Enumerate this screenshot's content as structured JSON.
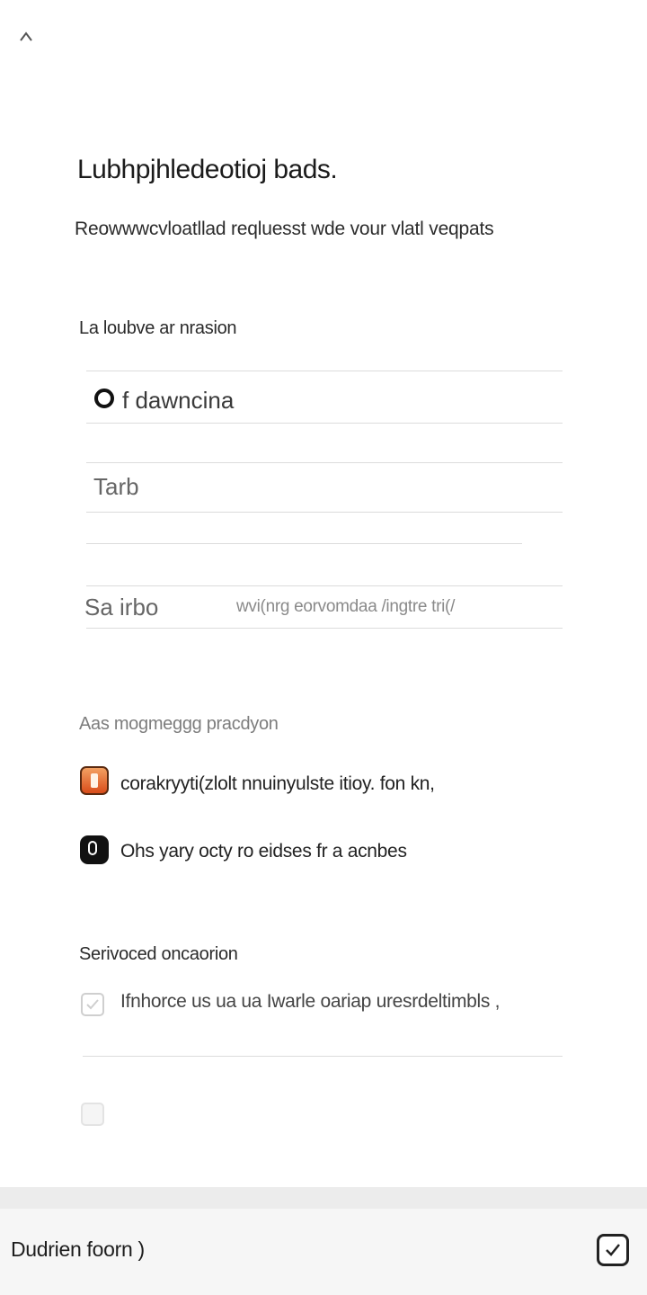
{
  "header": {
    "back_icon": "chevron-left-icon",
    "title": "Lubhpjhledeotioj bads.",
    "subtitle": "Reowwwcvloatllad reqluesst wde vour vlatl veqpats"
  },
  "section_one": {
    "label": "La loubve ar nrasion",
    "fields": [
      {
        "text": "f dawncina",
        "selected": true
      },
      {
        "text": "Tarb"
      },
      {
        "text": "Sa  irbo",
        "hint": "wvi(nrg  eorvomdaa /ingtre tri(/"
      }
    ]
  },
  "section_two": {
    "label": "Aas mogmeggg pracdyon",
    "options": [
      {
        "icon": "document-app-icon",
        "text": "corakryyti(zlolt nnuinyulste itioy. fon kn,"
      },
      {
        "icon": "phone-app-icon",
        "text": "Ohs yary octy ro eidses fr a acnbes"
      }
    ]
  },
  "section_three": {
    "label": "Serivoced oncaorion",
    "checkbox_text": "Ifnhorce  us  ua  ua  Iwarle  oariap  uresrdeltimbls ,"
  },
  "footer": {
    "label": "Dudrien foorn )",
    "next_icon": "checkbox-confirm-icon"
  }
}
